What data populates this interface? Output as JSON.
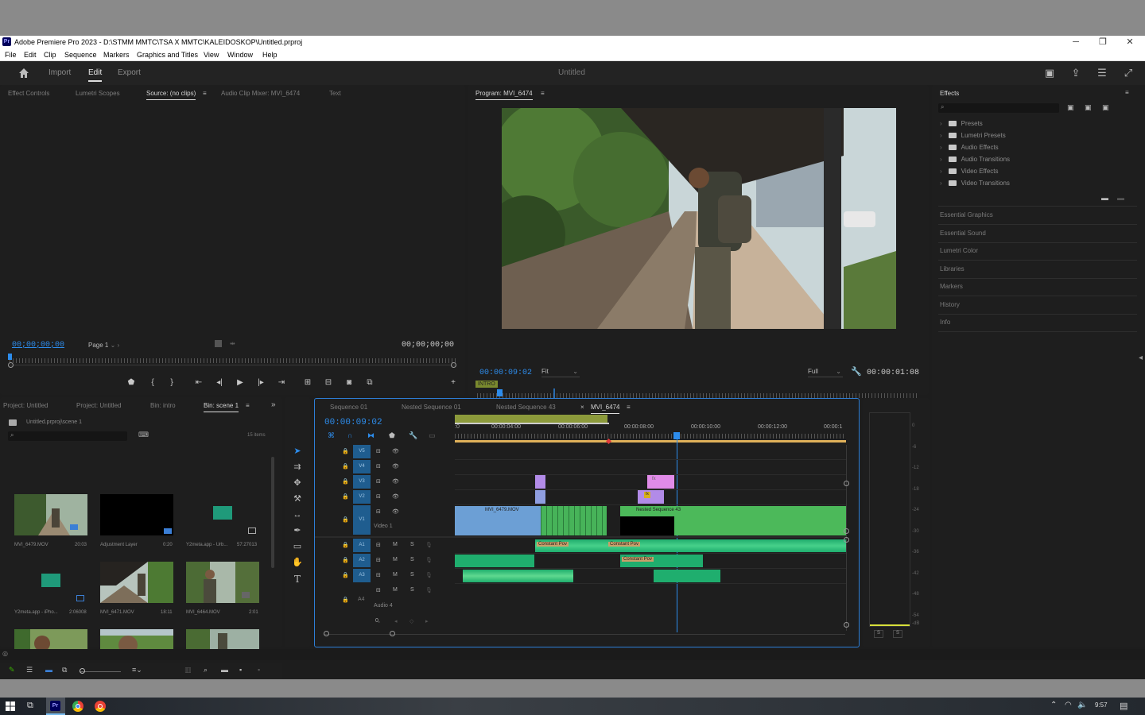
{
  "window": {
    "title": "Adobe Premiere Pro 2023 - D:\\STMM MMTC\\TSA X MMTC\\KALEIDOSKOP\\Untitled.prproj",
    "app_badge": "Pr",
    "minimize": "─",
    "maximize": "❐",
    "close": "✕"
  },
  "menu": [
    "File",
    "Edit",
    "Clip",
    "Sequence",
    "Markers",
    "Graphics and Titles",
    "View",
    "Window",
    "Help"
  ],
  "header": {
    "workspaces": [
      "Import",
      "Edit",
      "Export"
    ],
    "active_workspace": "Edit",
    "project_title": "Untitled"
  },
  "source_panel": {
    "tabs": [
      "Effect Controls",
      "Lumetri Scopes",
      "Source: (no clips)",
      "Audio Clip Mixer: MVI_6474",
      "Text"
    ],
    "active_tab": "Source: (no clips)",
    "timecode_left": "00;00;00;00",
    "timecode_right": "00;00;00;00",
    "page": "Page 1"
  },
  "program_panel": {
    "title": "Program: MVI_6474",
    "timecode": "00:00:09:02",
    "fit": "Fit",
    "quality": "Full",
    "duration": "00:00:01:08",
    "marker_label": "INTRO"
  },
  "effects_panel": {
    "title": "Effects",
    "folders": [
      "Presets",
      "Lumetri Presets",
      "Audio Effects",
      "Audio Transitions",
      "Video Effects",
      "Video Transitions"
    ],
    "sections": [
      "Essential Graphics",
      "Essential Sound",
      "Lumetri Color",
      "Libraries",
      "Markers",
      "History",
      "Info"
    ]
  },
  "project_panel": {
    "tabs": [
      "Project: Untitled",
      "Project: Untitled",
      "Bin: intro",
      "Bin: scene 1"
    ],
    "active_tab": "Bin: scene 1",
    "path": "Untitled.prproj\\scene 1",
    "item_count": "15 items",
    "items": [
      {
        "name": "MVI_6479.MOV",
        "duration": "20:03"
      },
      {
        "name": "Adjustment Layer",
        "duration": "0:20"
      },
      {
        "name": "Y2meta.app - Urb...",
        "duration": "57:27013"
      },
      {
        "name": "Y2meta.app - iPho...",
        "duration": "2:06008"
      },
      {
        "name": "MVI_6471.MOV",
        "duration": "18:11"
      },
      {
        "name": "MVI_6464.MOV",
        "duration": "2:01"
      }
    ]
  },
  "timeline": {
    "tabs": [
      "Sequence 01",
      "Nested Sequence 01",
      "Nested Sequence 43",
      "MVI_6474"
    ],
    "active_tab": "MVI_6474",
    "close_glyph": "×",
    "timecode": "00:00:09:02",
    "ruler": [
      ":0",
      "00:00:04:00",
      "00:00:06:00",
      "00:00:08:00",
      "00:00:10:00",
      "00:00:12:00",
      "00:00:1"
    ],
    "video_tracks": [
      "V5",
      "V4",
      "V3",
      "V2",
      "V1"
    ],
    "audio_tracks": [
      "A1",
      "A2",
      "A3",
      "A4"
    ],
    "video1_name": "Video 1",
    "audio4_name": "Audio 4",
    "clip_v1a": "MVI_6479.MOV",
    "clip_v1b": "Nested Sequence 43",
    "clip_a1a": "Constant Pov",
    "clip_a1b": "Constant Pov",
    "clip_a2": "Constant Pov",
    "fx_badge": "fx",
    "track_m": "M",
    "track_s": "S",
    "track_o": "O",
    "master_label": "0,"
  },
  "meters": {
    "scale": [
      "0",
      "-6",
      "-12",
      "-18",
      "-24",
      "-30",
      "-36",
      "-42",
      "-48",
      "-54",
      "-dB"
    ],
    "solo": [
      "S",
      "S"
    ]
  },
  "taskbar": {
    "time": "9:57"
  }
}
